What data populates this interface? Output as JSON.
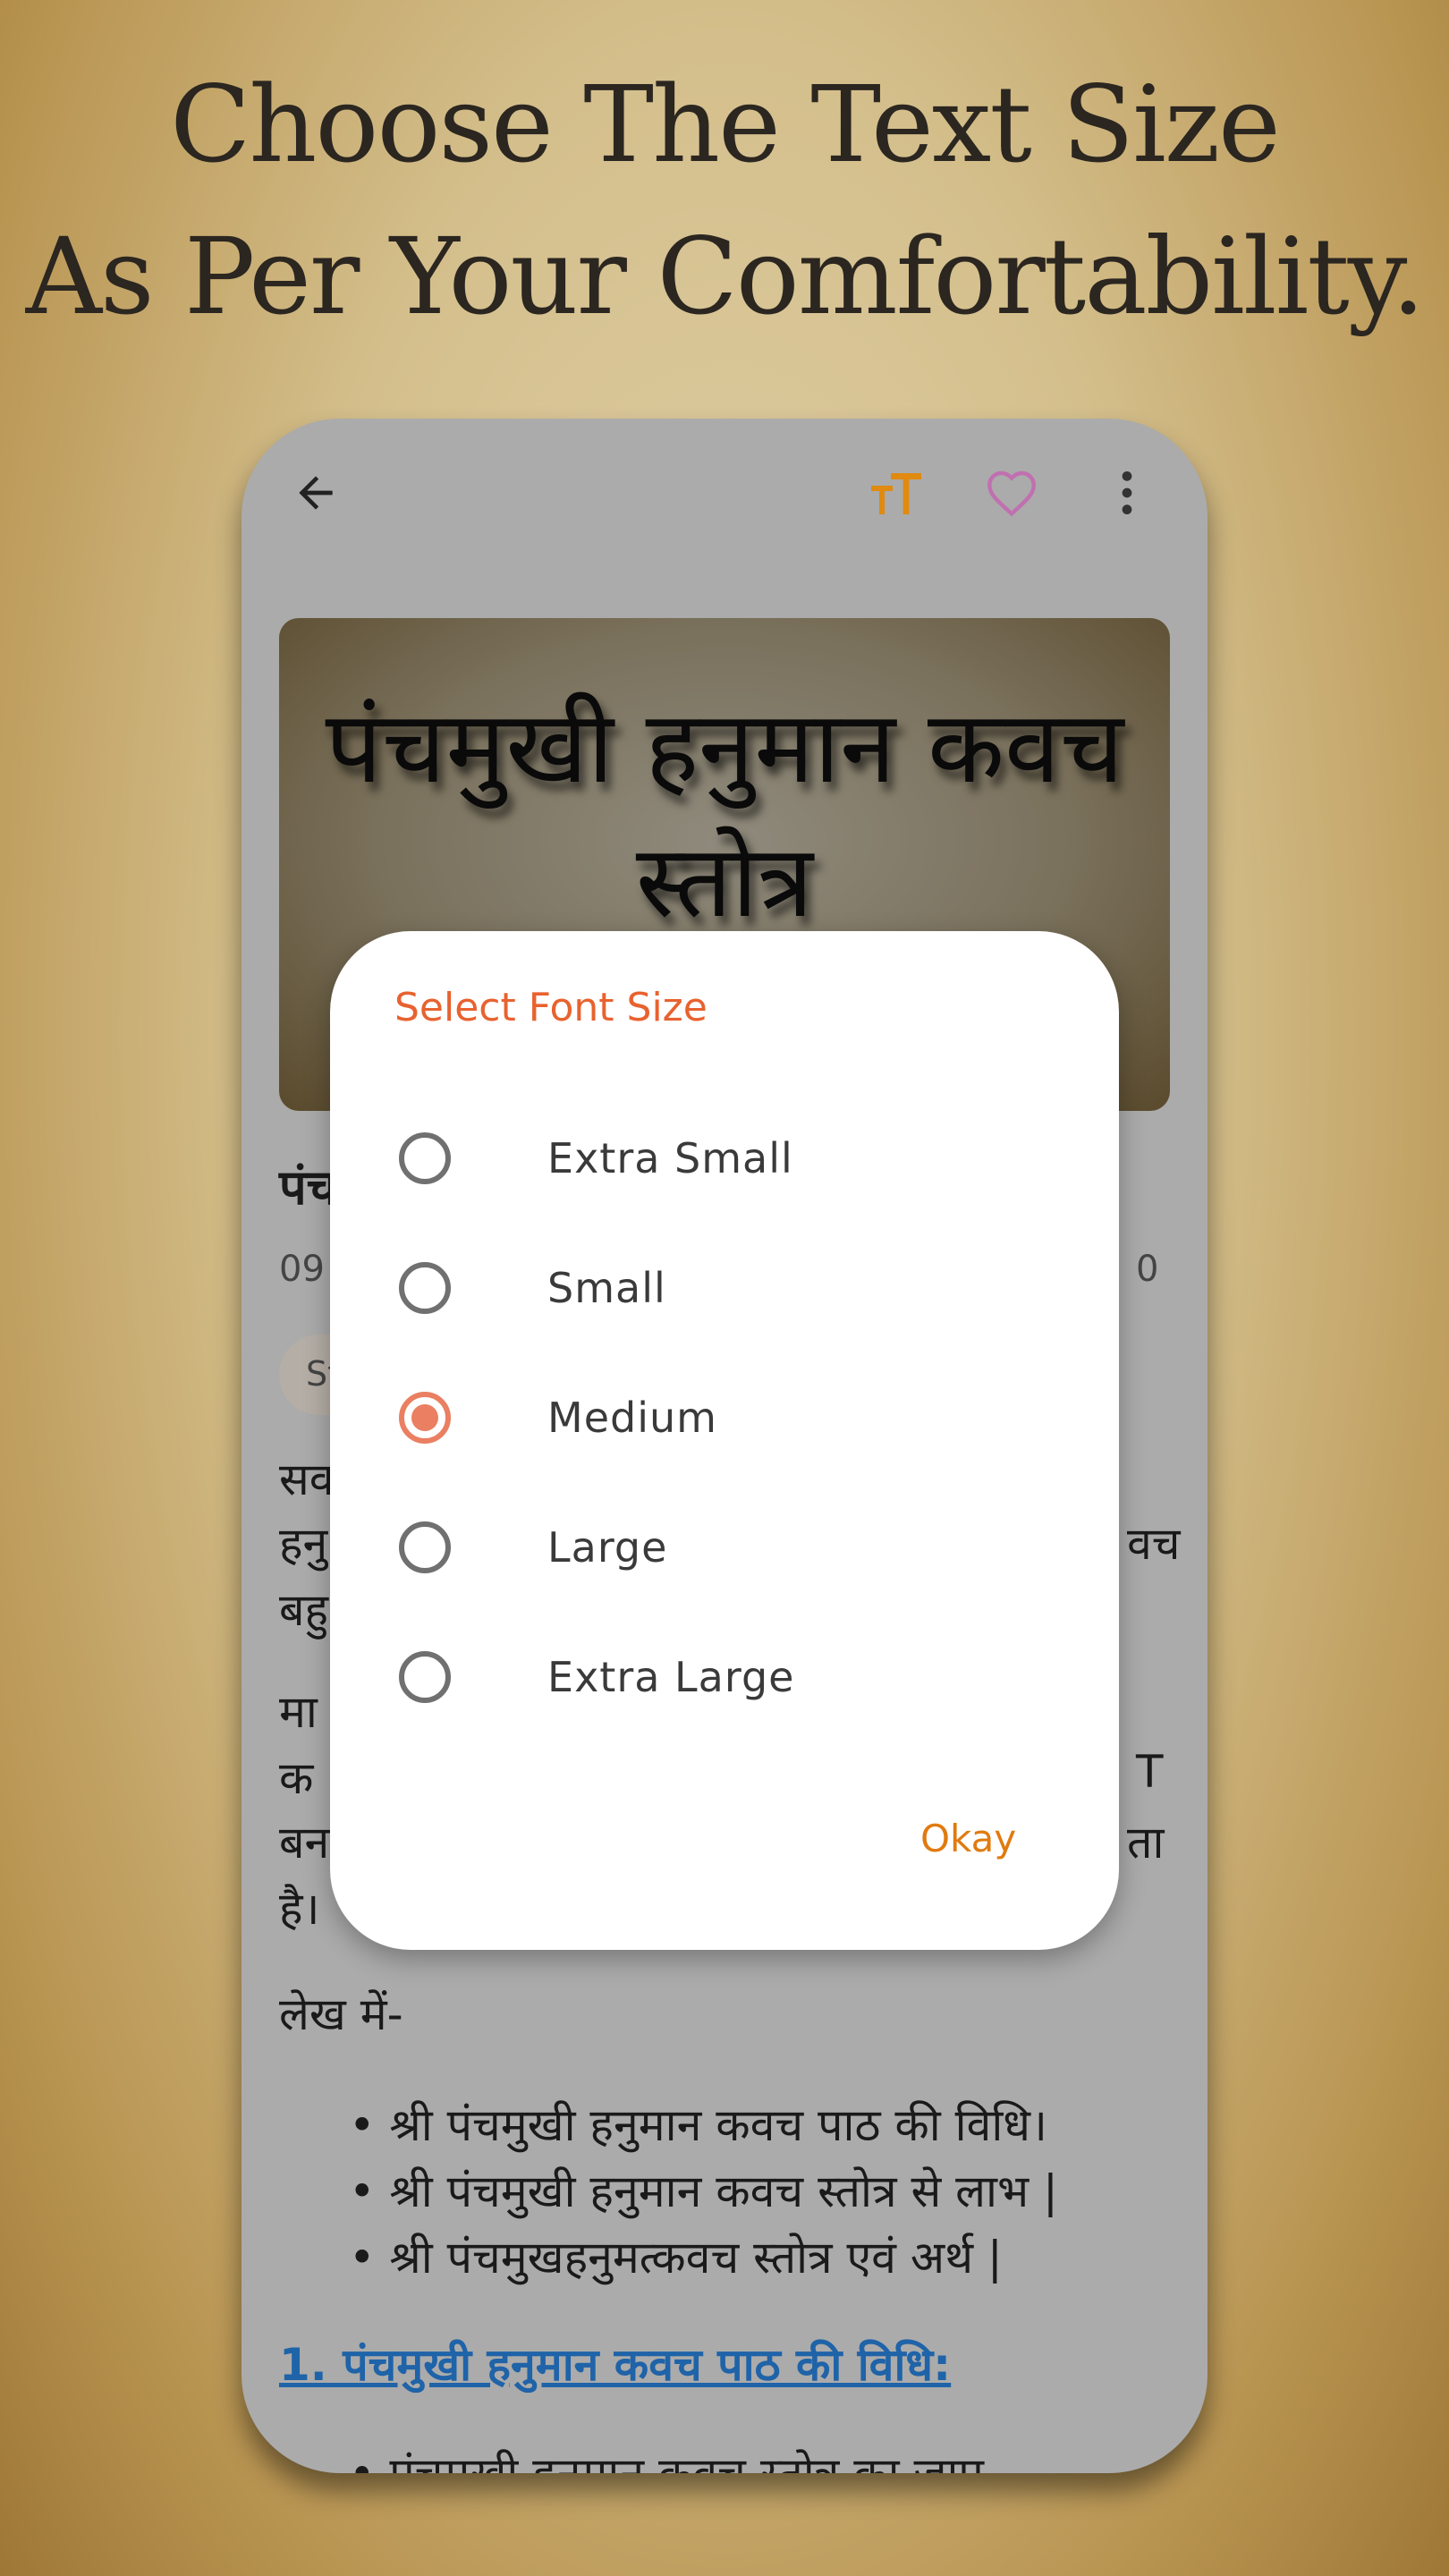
{
  "headline": {
    "line1": "Choose The Text Size",
    "line2": "As Per Your Comfortability."
  },
  "toolbar": {
    "back_icon": "arrow-left",
    "text_size_icon": "text-size",
    "favorite_icon": "heart-outline",
    "more_icon": "more-vertical",
    "accent": "#e08a10",
    "heart_color": "#c070b0"
  },
  "article": {
    "banner_title": "पंचमुखी हनुमान कवच स्तोत्र",
    "title_fragment": "पंच",
    "meta_left": "09",
    "meta_right": "0",
    "chip_fragment": "St",
    "para_fragments_left": [
      "सव",
      "हनु",
      "बहु",
      "मा",
      "क",
      "बन",
      "है।"
    ],
    "para_fragments_right": [
      "वच",
      "T",
      "ता"
    ],
    "intro": "लेख में-",
    "bullets": [
      "श्री पंचमुखी हनुमान कवच पाठ की विधि।",
      "श्री पंचमुखी हनुमान कवच स्तोत्र से लाभ |",
      "श्री पंचमुखहनुमत्कवच स्तोत्र एवं अर्थ |"
    ],
    "section_heading": "1. पंचमुखी हनुमान कवच पाठ की विधि:",
    "last_bullet": "पंचमुखी हनुमान कवच स्तोत्र का जाप"
  },
  "dialog": {
    "title": "Select Font Size",
    "options": [
      "Extra Small",
      "Small",
      "Medium",
      "Large",
      "Extra Large"
    ],
    "selected": "Medium",
    "ok_label": "Okay",
    "title_color": "#e8622f",
    "radio_selected_color": "#ea7f62"
  }
}
